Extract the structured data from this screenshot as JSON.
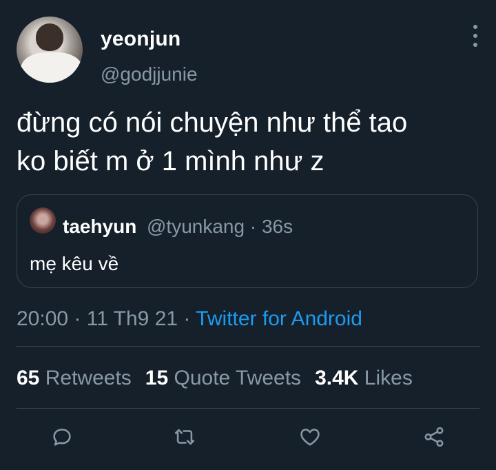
{
  "author": {
    "name": "yeonjun",
    "handle": "@godjjunie"
  },
  "tweet": {
    "text_line1": "đừng có nói chuyện như thể tao",
    "text_line2": "ko biết m ở 1 mình như z"
  },
  "quoted": {
    "name": "taehyun",
    "meta": "@tyunkang · 36s",
    "text": "mẹ kêu về"
  },
  "timestamp": {
    "time_date": "20:00 · 11 Th9 21 · ",
    "source": "Twitter for Android"
  },
  "stats": {
    "retweets_count": "65",
    "retweets_label": "Retweets",
    "quotes_count": "15",
    "quotes_label": "Quote Tweets",
    "likes_count": "3.4K",
    "likes_label": "Likes"
  },
  "actions": [
    "reply-icon",
    "retweet-icon",
    "like-icon",
    "share-icon"
  ],
  "colors": {
    "background": "#15202b",
    "secondary_text": "#8899a6",
    "link": "#1d9bf0",
    "border": "#38444d"
  }
}
